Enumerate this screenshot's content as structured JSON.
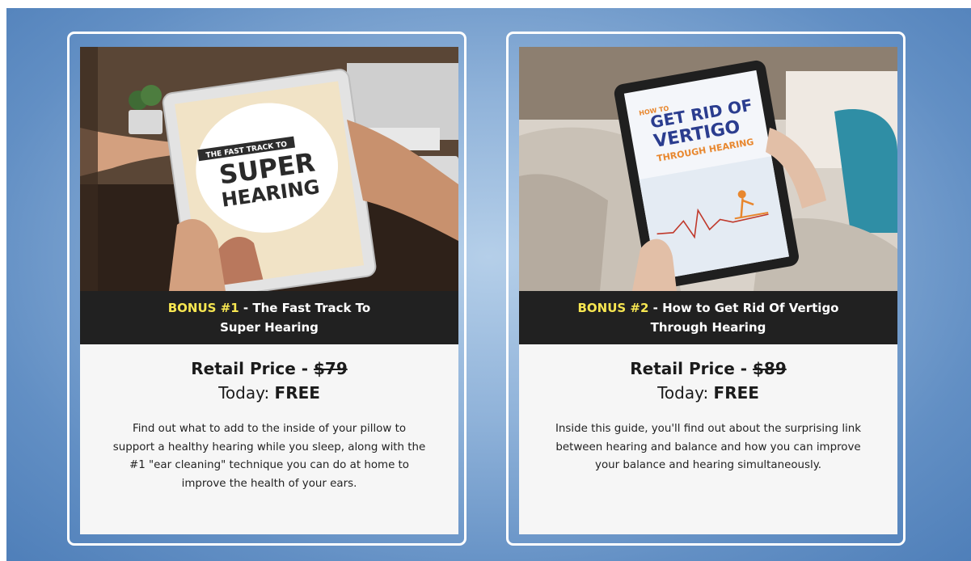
{
  "cards": [
    {
      "bonus_label": "BONUS #1",
      "title_line1": " - The Fast Track To",
      "title_line2": "Super Hearing",
      "price_label": "Retail Price - ",
      "price_old": "$79",
      "today_label": "Today: ",
      "today_value": "FREE",
      "description": "Find out what to add to the inside of your pillow to support a healthy hearing while you sleep, along with the #1 \"ear cleaning\" technique you can do at home to improve the health of your ears.",
      "cover": {
        "line1": "THE FAST TRACK TO",
        "line2": "SUPER",
        "line3": "HEARING"
      }
    },
    {
      "bonus_label": "BONUS #2",
      "title_line1": " - How to Get Rid Of Vertigo",
      "title_line2": "Through Hearing",
      "price_label": "Retail Price - ",
      "price_old": "$89",
      "today_label": "Today: ",
      "today_value": "FREE",
      "description": "Inside this guide, you'll find out about the surprising link between hearing and balance and how you can improve your balance and hearing simultaneously.",
      "cover": {
        "small": "HOW TO",
        "line1": "GET RID OF",
        "line2": "VERTIGO",
        "line3": "THROUGH HEARING"
      }
    }
  ],
  "colors": {
    "bonus": "#f7e651",
    "banner": "#212121",
    "panel": "#f6f6f6",
    "accent_blue": "#2b3d8f",
    "accent_orange": "#e8872e"
  }
}
